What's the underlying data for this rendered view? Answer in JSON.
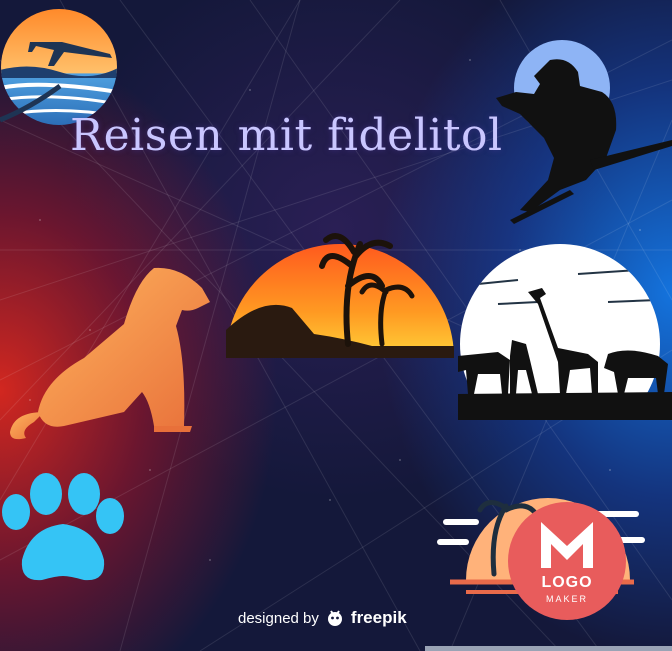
{
  "title": "Reisen mit fidelitol",
  "credit": {
    "prefix": "designed by",
    "brand": "freepik"
  },
  "logo_badge": {
    "line1": "LOGO",
    "line2": "MAKER"
  },
  "icons": [
    "airplane-sunset-icon",
    "photographer-silhouette-icon",
    "cougar-icon",
    "palm-sunset-icon",
    "safari-animals-icon",
    "paw-print-icon",
    "island-sunset-icon",
    "logo-maker-badge-icon"
  ],
  "colors": {
    "title": "#c9c6ff",
    "paw": "#35c4f5",
    "badge": "#e85c5c",
    "sunset_orange": "#ff8a1e"
  }
}
